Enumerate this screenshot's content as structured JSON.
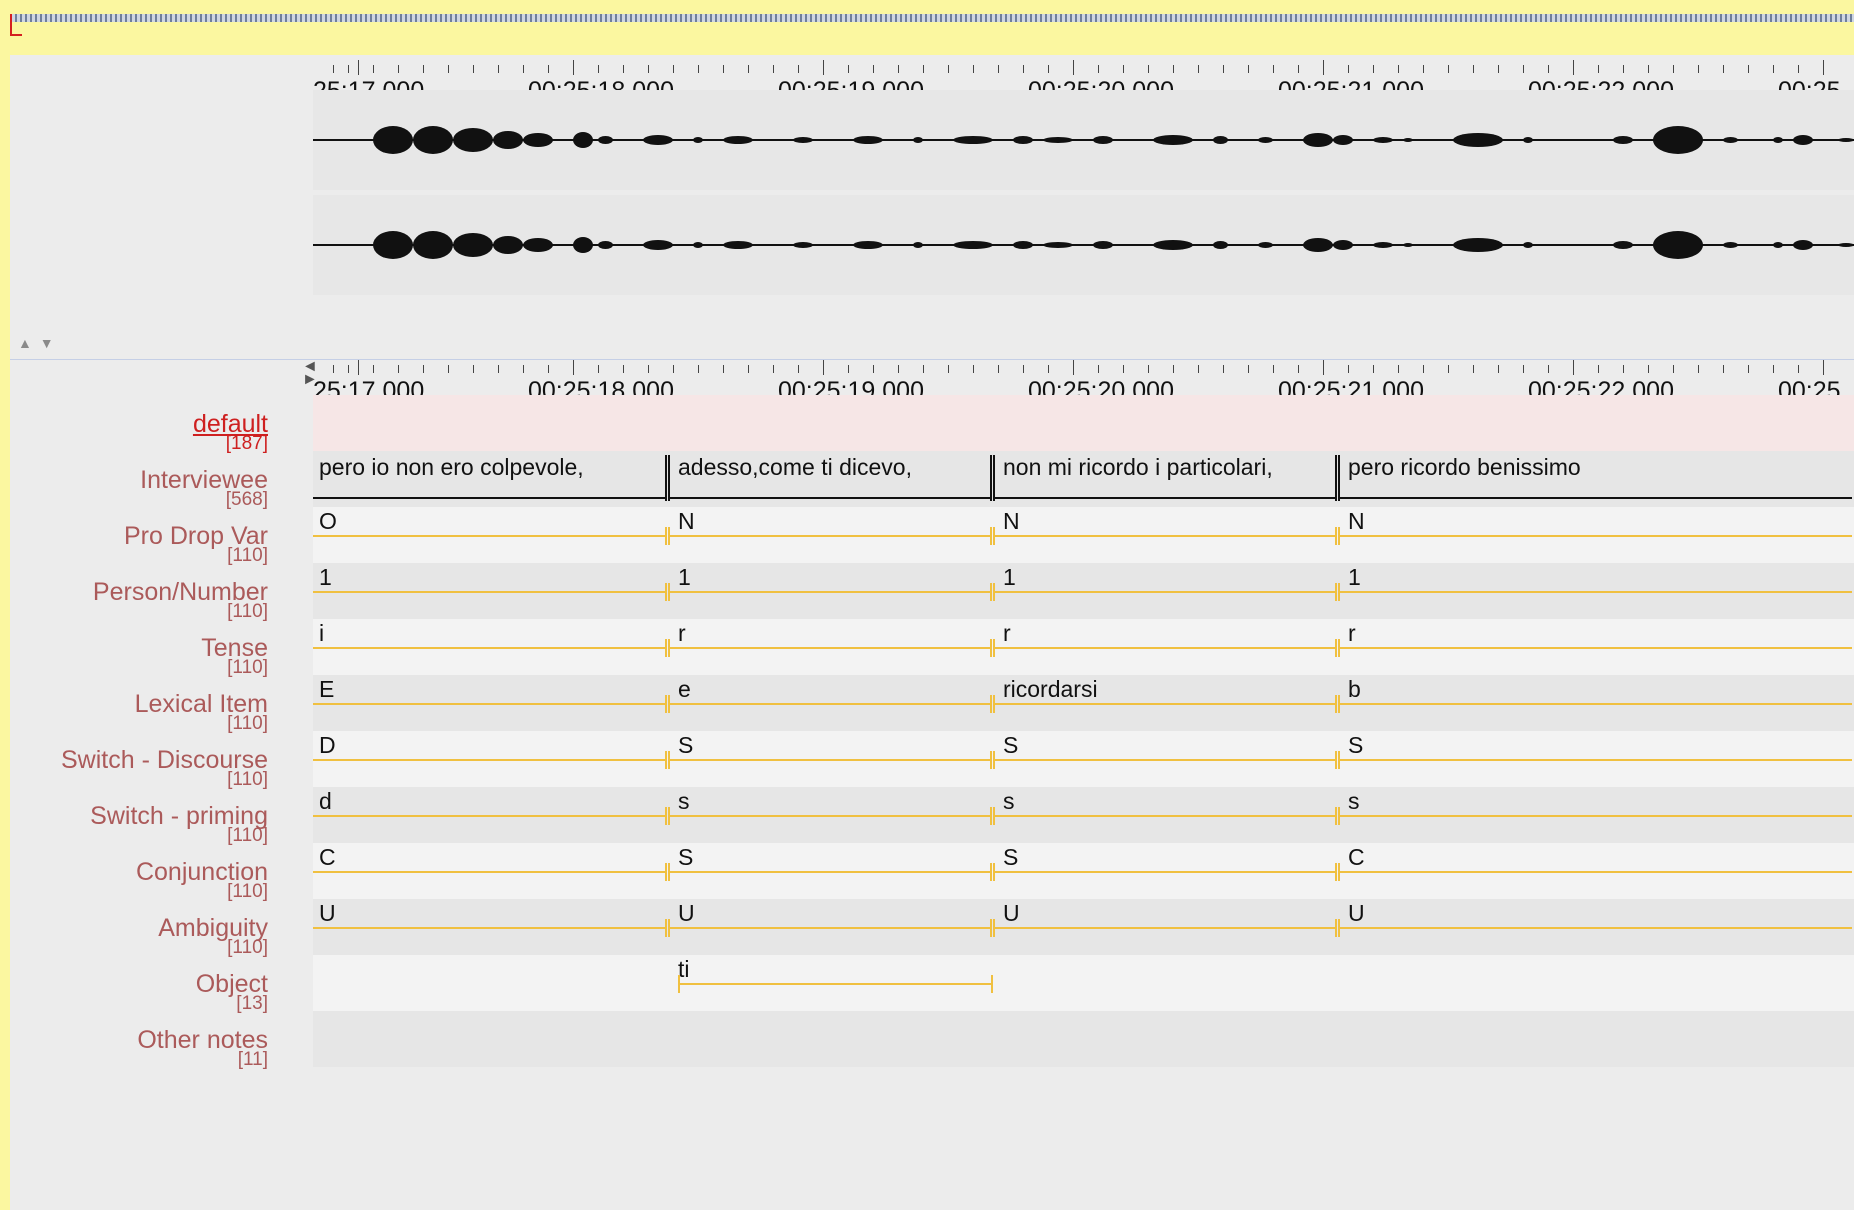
{
  "time_ruler": {
    "labels": [
      "25:17.000",
      "00:25:18.000",
      "00:25:19.000",
      "00:25:20.000",
      "00:25:21.000",
      "00:25:22.000",
      "00:25"
    ]
  },
  "waveform": {
    "channels": 2
  },
  "scroll_arrows": "▲ ▼",
  "tiers": [
    {
      "name": "default",
      "count": "[187]",
      "active": true,
      "color": "#ce2020"
    },
    {
      "name": "Interviewee",
      "count": "[568]"
    },
    {
      "name": "Pro Drop Var",
      "count": "[110]"
    },
    {
      "name": "Person/Number",
      "count": "[110]"
    },
    {
      "name": "Tense",
      "count": "[110]"
    },
    {
      "name": "Lexical Item",
      "count": "[110]"
    },
    {
      "name": "Switch - Discourse",
      "count": "[110]"
    },
    {
      "name": "Switch - priming",
      "count": "[110]"
    },
    {
      "name": "Conjunction",
      "count": "[110]"
    },
    {
      "name": "Ambiguity",
      "count": "[110]"
    },
    {
      "name": "Object",
      "count": "[13]"
    },
    {
      "name": "Other notes",
      "count": "[11]"
    }
  ],
  "annotations": {
    "interviewee": [
      "pero io non ero colpevole,",
      "adesso,come ti dicevo,",
      "non mi ricordo i particolari,",
      "pero ricordo benissimo"
    ],
    "pro_drop_var": [
      "O",
      "N",
      "N",
      "N"
    ],
    "person_number": [
      "1",
      "1",
      "1",
      "1"
    ],
    "tense": [
      "i",
      "r",
      "r",
      "r"
    ],
    "lexical_item": [
      "E",
      "e",
      "ricordarsi",
      "b"
    ],
    "switch_discourse": [
      "D",
      "S",
      "S",
      "S"
    ],
    "switch_priming": [
      "d",
      "s",
      "s",
      "s"
    ],
    "conjunction": [
      "C",
      "S",
      "S",
      "C"
    ],
    "ambiguity": [
      "U",
      "U",
      "U",
      "U"
    ],
    "object": [
      "ti"
    ]
  },
  "colors": {
    "title_bar": "#fbf7a0",
    "tier_label": "#ab5a5a",
    "active_tier": "#ce2020",
    "dependent_line": "#f0c040",
    "interviewee_line": "#111111"
  }
}
